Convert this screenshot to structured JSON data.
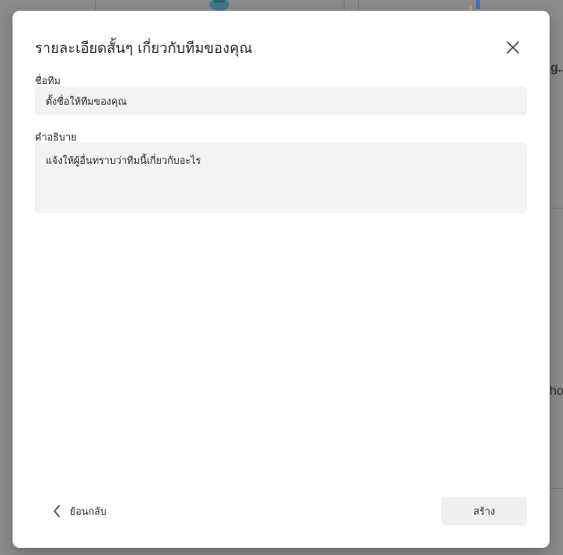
{
  "dialog": {
    "title": "รายละเอียดสั้นๆ เกี่ยวกับทีมของคุณ",
    "team_name_label": "ชื่อทีม",
    "team_name_placeholder": "ตั้งชื่อให้ทีมของคุณ",
    "description_label": "คำอธิบาย",
    "description_placeholder": "แจ้งให้ผู้อื่นทราบว่าทีมนี้เกี่ยวกับอะไร",
    "back_label": "ย้อนกลับ",
    "create_label": "สร้าง"
  },
  "background": {
    "fragment_top_right": "g...",
    "fragment_mid_right": "ho"
  },
  "colors": {
    "backdrop": "#8c8c8c",
    "dialog_bg": "#ffffff",
    "field_bg": "#f3f3f3",
    "button_bg": "#f0f0f0",
    "text": "#242424"
  },
  "icons": {
    "close": "close-icon",
    "back": "chevron-left-icon"
  }
}
